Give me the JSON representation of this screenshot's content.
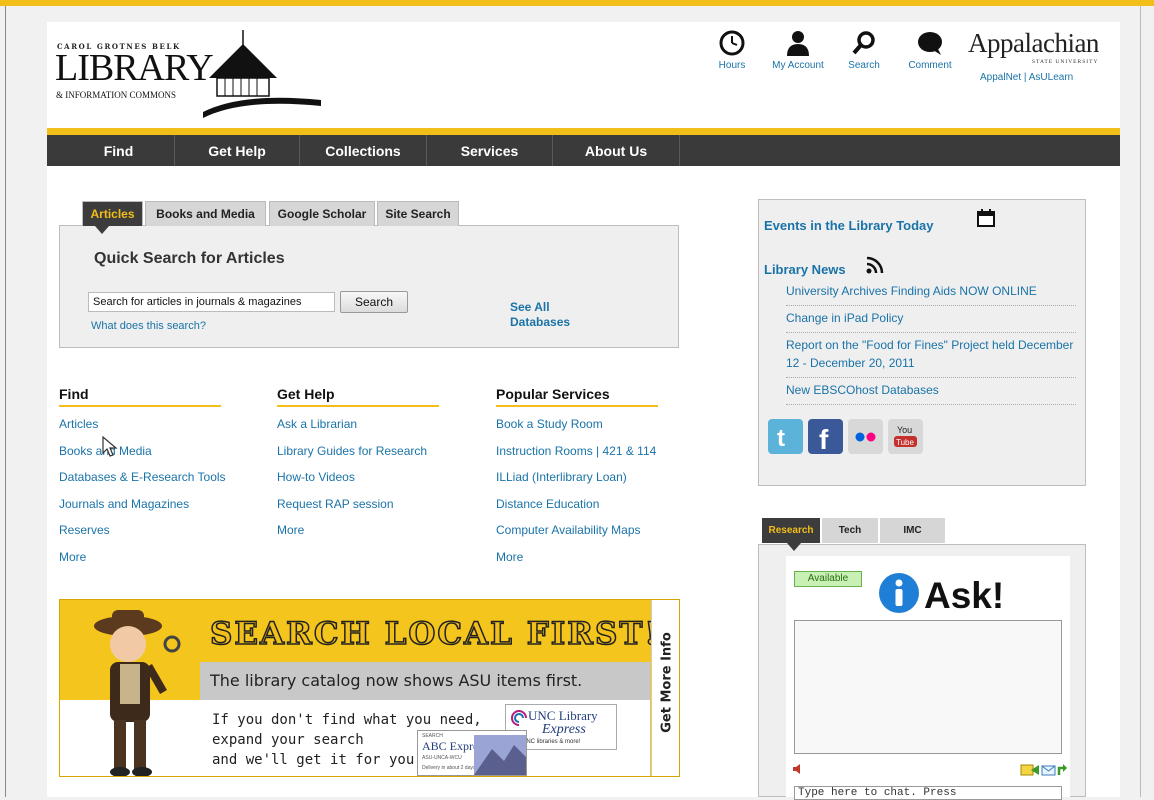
{
  "colors": {
    "gold": "#f2be1a",
    "nav_bg": "#3a3a3a",
    "link": "#1a73a8"
  },
  "header": {
    "logo": {
      "top_text": "CAROL GROTNES BELK",
      "main_text": "LIBRARY",
      "sub_text": "& INFORMATION COMMONS"
    },
    "icons": [
      {
        "label": "Hours",
        "icon": "clock-icon"
      },
      {
        "label": "My Account",
        "icon": "person-icon"
      },
      {
        "label": "Search",
        "icon": "magnifier-icon"
      },
      {
        "label": "Comment",
        "icon": "speech-bubble-icon"
      }
    ],
    "university": {
      "name": "Appalachian",
      "tagline": "STATE UNIVERSITY",
      "links": "AppalNet | AsULearn"
    }
  },
  "nav": [
    "Find",
    "Get Help",
    "Collections",
    "Services",
    "About Us"
  ],
  "search": {
    "tabs": [
      "Articles",
      "Books and Media",
      "Google Scholar",
      "Site Search"
    ],
    "active_tab": "Articles",
    "title": "Quick Search for Articles",
    "input_value": "Search for articles in journals & magazines",
    "button": "Search",
    "help_link": "What does this search?",
    "databases_link": "See All Databases"
  },
  "columns": {
    "find": {
      "title": "Find",
      "links": [
        "Articles",
        "Books and Media",
        "Databases & E-Research Tools",
        "Journals and Magazines",
        "Reserves",
        "More"
      ]
    },
    "gethelp": {
      "title": "Get Help",
      "links": [
        "Ask a Librarian",
        "Library Guides for Research",
        "How-to Videos",
        "Request RAP session",
        "More"
      ]
    },
    "services": {
      "title": "Popular Services",
      "links": [
        "Book a Study Room",
        "Instruction Rooms | 421 & 114",
        "ILLiad (Interlibrary Loan)",
        "Distance Education",
        "Computer Availability Maps",
        "More"
      ]
    }
  },
  "banner": {
    "headline": "SEARCH LOCAL FIRST!",
    "line1": "The library catalog now shows ASU items first.",
    "line2": [
      "If you don't find what you need,",
      "expand your search",
      "and we'll get it for you."
    ],
    "side": "Get More Info",
    "unc": {
      "t1": "UNC Library",
      "t2": "Express",
      "t3": "...h UNC libraries & more!"
    },
    "abc": {
      "t1": "SEARCH",
      "t2": "ABC Express",
      "t3": "ASU-UNCA-WCU",
      "t4": "Delivery in about 2 days"
    }
  },
  "sidebar": {
    "events": "Events in the Library Today",
    "news_title": "Library News",
    "news": [
      "University Archives Finding Aids NOW ONLINE",
      "Change in iPad Policy",
      "Report on the \"Food for Fines\" Project held December 12 - December 20, 2011",
      "New EBSCOhost Databases"
    ],
    "social": [
      {
        "icon": "twitter-icon",
        "color": "#5bb3d9"
      },
      {
        "icon": "facebook-icon",
        "color": "#3b5998"
      },
      {
        "icon": "flickr-icon",
        "color": "#d8d8d8"
      },
      {
        "icon": "youtube-icon",
        "color": "#c4302b"
      }
    ],
    "youtube_text": {
      "you": "You",
      "tube": "Tube"
    },
    "chat_tabs": [
      "Research",
      "Tech",
      "IMC"
    ],
    "available": "Available",
    "ask": "Ask!",
    "chat_placeholder": "Type here to chat. Press"
  }
}
